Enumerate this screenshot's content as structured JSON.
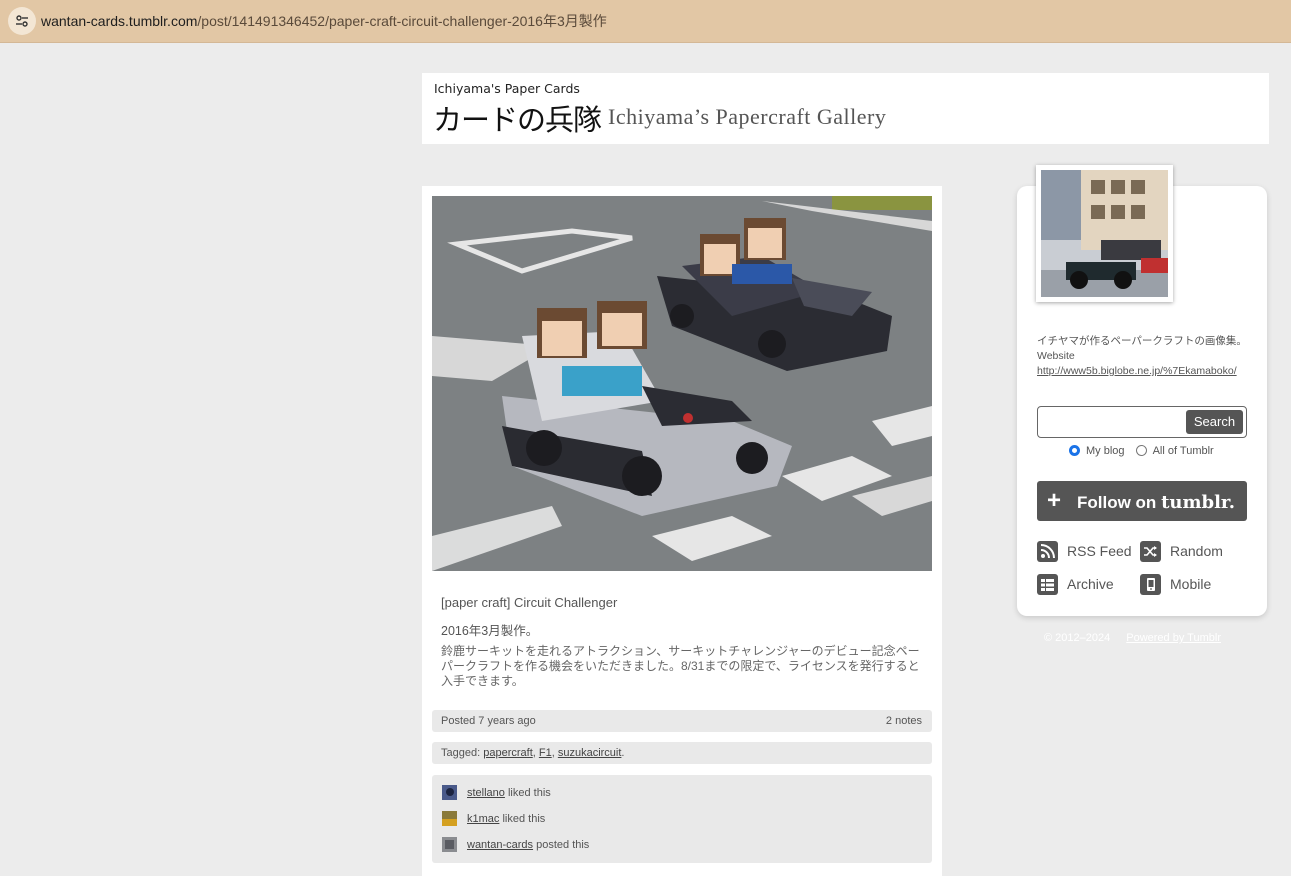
{
  "browser": {
    "url_host": "wantan-cards.tumblr.com",
    "url_path": "/post/141491346452/paper-craft-circuit-challenger-2016年3月製作"
  },
  "header": {
    "small_title": "Ichiyama's Paper Cards",
    "jp_title": "カードの兵隊",
    "en_title": "Ichiyama’s Papercraft Gallery"
  },
  "post": {
    "image_icon": "papercraft-karts-photo",
    "title": "[paper craft] Circuit Challenger",
    "date": "2016年3月製作。",
    "body": "鈴鹿サーキットを走れるアトラクション、サーキットチャレンジャーのデビュー記念ペーパークラフトを作る機会をいただきました。8/31までの限定で、ライセンスを発行すると入手できます。",
    "posted": "Posted 7 years ago",
    "notes_count": "2 notes",
    "tagged_label": "Tagged:",
    "tags": [
      "papercraft",
      "F1",
      "suzukacircuit"
    ],
    "notes": [
      {
        "user": "stellano",
        "action": "liked this"
      },
      {
        "user": "k1mac",
        "action": "liked this"
      },
      {
        "user": "wantan-cards",
        "action": "posted this"
      }
    ]
  },
  "sidebar": {
    "description": "イチヤマが作るペーパークラフトの画像集。Website",
    "website": "http://www5b.biglobe.ne.jp/%7Ekamaboko/",
    "search_placeholder": "",
    "search_button": "Search",
    "radio_my_blog": "My blog",
    "radio_all": "All of Tumblr",
    "follow_prefix": "Follow on",
    "follow_brand": "tumblr.",
    "links": {
      "rss": "RSS Feed",
      "random": "Random",
      "archive": "Archive",
      "mobile": "Mobile"
    }
  },
  "footer": {
    "copyright": "© 2012–2024",
    "powered": "Powered by Tumblr"
  },
  "colors": {
    "address_bar": "#e2c7a5",
    "page_bg": "#ececec",
    "button_dark": "#555555",
    "radio_accent": "#1a73e8"
  }
}
